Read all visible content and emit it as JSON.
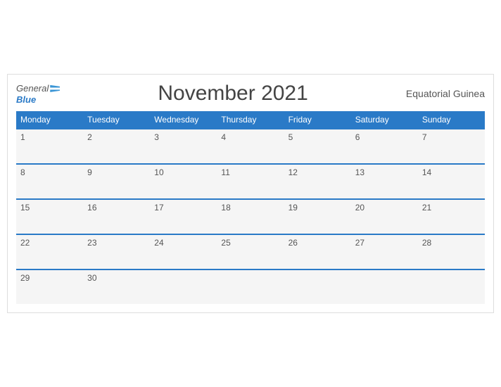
{
  "header": {
    "logo_general": "General",
    "logo_blue": "Blue",
    "title": "November 2021",
    "country": "Equatorial Guinea"
  },
  "days_of_week": [
    "Monday",
    "Tuesday",
    "Wednesday",
    "Thursday",
    "Friday",
    "Saturday",
    "Sunday"
  ],
  "weeks": [
    [
      "1",
      "2",
      "3",
      "4",
      "5",
      "6",
      "7"
    ],
    [
      "8",
      "9",
      "10",
      "11",
      "12",
      "13",
      "14"
    ],
    [
      "15",
      "16",
      "17",
      "18",
      "19",
      "20",
      "21"
    ],
    [
      "22",
      "23",
      "24",
      "25",
      "26",
      "27",
      "28"
    ],
    [
      "29",
      "30",
      "",
      "",
      "",
      "",
      ""
    ]
  ]
}
